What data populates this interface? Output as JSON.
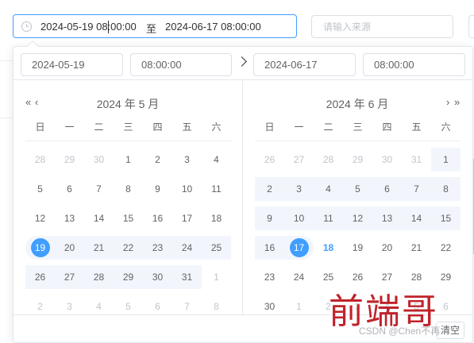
{
  "range": {
    "start": "2024-05-19 08:00:00",
    "separator": "至",
    "end": "2024-06-17 08:00:00"
  },
  "source": {
    "placeholder": "请输入来源"
  },
  "time_header": {
    "start_date": "2024-05-19",
    "start_time": "08:00:00",
    "end_date": "2024-06-17",
    "end_time": "08:00:00"
  },
  "weekdays": [
    "日",
    "一",
    "二",
    "三",
    "四",
    "五",
    "六"
  ],
  "left": {
    "title": "2024 年 5 月",
    "prev_year": "«",
    "prev_month": "‹",
    "days": [
      [
        "28",
        "29",
        "30",
        "1",
        "2",
        "3",
        "4"
      ],
      [
        "5",
        "6",
        "7",
        "8",
        "9",
        "10",
        "11"
      ],
      [
        "12",
        "13",
        "14",
        "15",
        "16",
        "17",
        "18"
      ],
      [
        "19",
        "20",
        "21",
        "22",
        "23",
        "24",
        "25"
      ],
      [
        "26",
        "27",
        "28",
        "29",
        "30",
        "31",
        "1"
      ],
      [
        "2",
        "3",
        "4",
        "5",
        "6",
        "7",
        "8"
      ]
    ]
  },
  "right": {
    "title": "2024 年 6 月",
    "next_month": "›",
    "next_year": "»",
    "days": [
      [
        "26",
        "27",
        "28",
        "29",
        "30",
        "31",
        "1"
      ],
      [
        "2",
        "3",
        "4",
        "5",
        "6",
        "7",
        "8"
      ],
      [
        "9",
        "10",
        "11",
        "12",
        "13",
        "14",
        "15"
      ],
      [
        "16",
        "17",
        "18",
        "19",
        "20",
        "21",
        "22"
      ],
      [
        "23",
        "24",
        "25",
        "26",
        "27",
        "28",
        "29"
      ],
      [
        "30",
        "1",
        "2",
        "3",
        "4",
        "5",
        "6"
      ]
    ]
  },
  "footer": {
    "clear_label": "清空"
  },
  "watermark": {
    "text_cn": "前端哥",
    "text_csdn": "CSDN @Chen不再"
  },
  "colors": {
    "accent": "#409eff",
    "range_bg": "#f2f6fc",
    "muted": "#c0c4cc"
  }
}
